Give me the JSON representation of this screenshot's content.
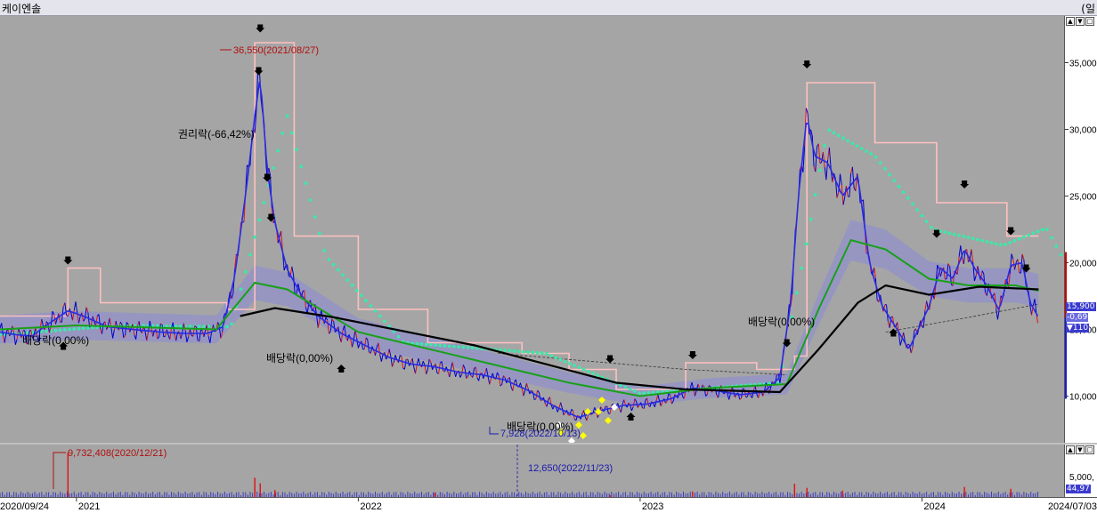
{
  "title": "케이엔솔",
  "corner_label": "(일",
  "colors": {
    "candle_up": "#e01010",
    "candle_down": "#0000cc",
    "ma_short": "#2a2ae0",
    "ma_mid": "#18a018",
    "ma_long": "#000000",
    "cloud": "#8a8ad8",
    "upper_band": "#ffc0c0",
    "dots": "#3ce8a8",
    "background": "#a5a5a5"
  },
  "price_axis": {
    "ticks": [
      "35,000",
      "30,000",
      "25,000",
      "20,000",
      "15,000",
      "10,000"
    ]
  },
  "volume_axis": {
    "ticks": [
      "5,000,"
    ]
  },
  "badges": {
    "last_price": "15,900",
    "change": "-0,69",
    "volume_ratio": "▼110",
    "last_volume": "44,97"
  },
  "date_axis": {
    "start": "2020/09/24",
    "end": "2024/07/03",
    "labels": [
      "2021",
      "2022",
      "2023",
      "2024"
    ]
  },
  "annotations": {
    "high": "36,550(2021/08/27)",
    "low": "7,928(2022/10/13)",
    "rights_drop": "권리락(-66,42%)",
    "dividend_1": "배당락(0,00%)",
    "dividend_2": "배당락(0,00%)",
    "dividend_3": "배당락(0,00%)",
    "dividend_4": "배당락(0,00%)",
    "volume_high": "9,732,408(2020/12/21)",
    "volume_low": "12,650(2022/11/23)"
  },
  "chart_data": {
    "type": "line",
    "x_range": [
      "2020-09-24",
      "2024-07-03"
    ],
    "ylim": [
      6500,
      38500
    ],
    "yticks": [
      10000,
      15000,
      20000,
      25000,
      30000,
      35000
    ],
    "grid": false,
    "close_series": [
      [
        "2020-09-24",
        14800
      ],
      [
        "2020-10-15",
        14600
      ],
      [
        "2020-11-05",
        14500
      ],
      [
        "2020-11-20",
        15200
      ],
      [
        "2020-12-21",
        16400
      ],
      [
        "2021-01-10",
        16000
      ],
      [
        "2021-02-10",
        15200
      ],
      [
        "2021-03-15",
        15000
      ],
      [
        "2021-04-20",
        14800
      ],
      [
        "2021-05-20",
        14700
      ],
      [
        "2021-06-20",
        14700
      ],
      [
        "2021-07-10",
        15200
      ],
      [
        "2021-07-25",
        19000
      ],
      [
        "2021-08-10",
        26000
      ],
      [
        "2021-08-20",
        31000
      ],
      [
        "2021-08-27",
        34000
      ],
      [
        "2021-09-05",
        27000
      ],
      [
        "2021-09-15",
        23000
      ],
      [
        "2021-10-01",
        19500
      ],
      [
        "2021-10-20",
        17500
      ],
      [
        "2021-11-10",
        16000
      ],
      [
        "2021-12-10",
        14700
      ],
      [
        "2022-01-10",
        13800
      ],
      [
        "2022-02-10",
        12900
      ],
      [
        "2022-03-10",
        12400
      ],
      [
        "2022-04-10",
        12200
      ],
      [
        "2022-05-10",
        11800
      ],
      [
        "2022-06-10",
        11600
      ],
      [
        "2022-07-10",
        11200
      ],
      [
        "2022-08-10",
        10400
      ],
      [
        "2022-09-10",
        9300
      ],
      [
        "2022-10-13",
        8400
      ],
      [
        "2022-11-10",
        8900
      ],
      [
        "2022-12-10",
        9300
      ],
      [
        "2023-01-10",
        9400
      ],
      [
        "2023-02-10",
        9800
      ],
      [
        "2023-03-10",
        10600
      ],
      [
        "2023-04-10",
        10400
      ],
      [
        "2023-05-10",
        10100
      ],
      [
        "2023-06-10",
        10300
      ],
      [
        "2023-07-01",
        11400
      ],
      [
        "2023-07-15",
        17000
      ],
      [
        "2023-07-25",
        25000
      ],
      [
        "2023-08-05",
        31000
      ],
      [
        "2023-08-15",
        28000
      ],
      [
        "2023-09-01",
        27500
      ],
      [
        "2023-09-20",
        25000
      ],
      [
        "2023-10-10",
        26500
      ],
      [
        "2023-10-25",
        20000
      ],
      [
        "2023-11-10",
        16800
      ],
      [
        "2023-12-01",
        14900
      ],
      [
        "2023-12-15",
        13500
      ],
      [
        "2024-01-10",
        16700
      ],
      [
        "2024-01-25",
        19600
      ],
      [
        "2024-02-10",
        18800
      ],
      [
        "2024-02-25",
        21000
      ],
      [
        "2024-03-10",
        19500
      ],
      [
        "2024-03-25",
        18300
      ],
      [
        "2024-04-10",
        16400
      ],
      [
        "2024-04-25",
        19800
      ],
      [
        "2024-05-10",
        20000
      ],
      [
        "2024-05-20",
        17000
      ],
      [
        "2024-05-31",
        15900
      ]
    ],
    "ma_mid_series": [
      [
        "2020-09-24",
        15000
      ],
      [
        "2021-01-01",
        15300
      ],
      [
        "2021-07-01",
        15000
      ],
      [
        "2021-08-20",
        18500
      ],
      [
        "2021-10-01",
        18000
      ],
      [
        "2022-01-01",
        14800
      ],
      [
        "2022-06-01",
        12700
      ],
      [
        "2022-10-01",
        11000
      ],
      [
        "2023-01-01",
        10000
      ],
      [
        "2023-04-01",
        10600
      ],
      [
        "2023-07-10",
        10900
      ],
      [
        "2023-08-20",
        16500
      ],
      [
        "2023-10-01",
        21700
      ],
      [
        "2023-11-15",
        21000
      ],
      [
        "2024-01-10",
        18800
      ],
      [
        "2024-03-01",
        18300
      ],
      [
        "2024-05-01",
        18300
      ],
      [
        "2024-05-31",
        17900
      ]
    ],
    "ma_long_series": [
      [
        "2021-08-01",
        16000
      ],
      [
        "2021-09-15",
        16600
      ],
      [
        "2021-12-01",
        15900
      ],
      [
        "2022-06-01",
        13800
      ],
      [
        "2022-12-01",
        11000
      ],
      [
        "2023-03-01",
        10500
      ],
      [
        "2023-07-01",
        10300
      ],
      [
        "2023-08-20",
        13500
      ],
      [
        "2023-10-10",
        17000
      ],
      [
        "2023-11-15",
        18300
      ],
      [
        "2024-01-10",
        17600
      ],
      [
        "2024-03-15",
        18200
      ],
      [
        "2024-05-31",
        18000
      ]
    ],
    "upper_band_series": [
      [
        "2020-09-24",
        16000
      ],
      [
        "2020-12-21",
        19600
      ],
      [
        "2021-02-01",
        17000
      ],
      [
        "2021-07-15",
        16500
      ],
      [
        "2021-08-20",
        36500
      ],
      [
        "2021-10-05",
        36500
      ],
      [
        "2021-10-10",
        22000
      ],
      [
        "2022-01-01",
        16500
      ],
      [
        "2022-04-01",
        14000
      ],
      [
        "2022-08-01",
        13200
      ],
      [
        "2022-10-01",
        12000
      ],
      [
        "2022-12-01",
        10500
      ],
      [
        "2023-03-01",
        12500
      ],
      [
        "2023-06-01",
        12000
      ],
      [
        "2023-07-20",
        13000
      ],
      [
        "2023-08-05",
        33500
      ],
      [
        "2023-09-15",
        33500
      ],
      [
        "2023-11-01",
        29000
      ],
      [
        "2024-01-20",
        24500
      ],
      [
        "2024-04-01",
        24500
      ],
      [
        "2024-04-20",
        22000
      ],
      [
        "2024-05-31",
        22000
      ]
    ],
    "dots_series": [
      [
        "2020-09-24",
        14600
      ],
      [
        "2021-03-01",
        15300
      ],
      [
        "2021-07-20",
        15200
      ],
      [
        "2021-10-01",
        31000
      ],
      [
        "2021-11-20",
        20500
      ],
      [
        "2022-03-01",
        14000
      ],
      [
        "2022-09-01",
        13200
      ],
      [
        "2023-01-01",
        10200
      ],
      [
        "2023-07-01",
        11000
      ],
      [
        "2023-09-01",
        30000
      ],
      [
        "2023-11-01",
        28000
      ],
      [
        "2024-01-15",
        22500
      ],
      [
        "2024-04-15",
        21300
      ],
      [
        "2024-06-10",
        22600
      ],
      [
        "2024-06-30",
        20500
      ]
    ],
    "volume": {
      "max_label_value": 9732408,
      "bars": [
        [
          "2020-12-21",
          9732408
        ],
        [
          "2021-08-20",
          4200000
        ],
        [
          "2021-08-27",
          3000000
        ],
        [
          "2021-09-15",
          1500000
        ],
        [
          "2022-04-10",
          900000
        ],
        [
          "2022-11-23",
          12650
        ],
        [
          "2023-03-10",
          1200000
        ],
        [
          "2023-07-20",
          2900000
        ],
        [
          "2023-08-05",
          2000000
        ],
        [
          "2023-09-20",
          1400000
        ],
        [
          "2024-02-25",
          2200000
        ],
        [
          "2024-04-25",
          1800000
        ]
      ]
    }
  }
}
